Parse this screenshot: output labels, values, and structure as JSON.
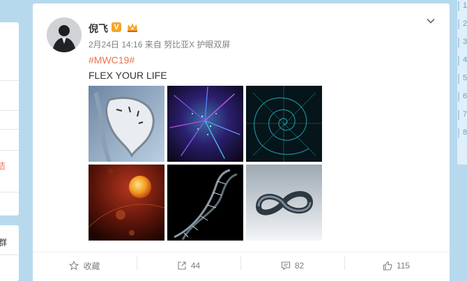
{
  "sidebar": {
    "fragments": [
      {
        "text": "",
        "style": "plain"
      },
      {
        "text": "洁",
        "style": "red"
      },
      {
        "text": "群",
        "style": "plain"
      },
      {
        "text": "",
        "style": "plain"
      }
    ]
  },
  "right_panel": {
    "fragments": [
      "1",
      "2",
      "3",
      "4",
      "5",
      "6",
      "7",
      "8"
    ]
  },
  "post": {
    "author": "倪飞",
    "verified_badge": "V",
    "time": "2月24日 14:16",
    "source_prefix": "来自",
    "source": "努比亚X 护眼双屏",
    "hashtag": "#MWC19#",
    "text": "FLEX YOUR LIFE",
    "images": [
      {
        "name": "melting-clock-image"
      },
      {
        "name": "starfield-image"
      },
      {
        "name": "spiral-image"
      },
      {
        "name": "planets-image"
      },
      {
        "name": "dna-helix-image"
      },
      {
        "name": "infinity-loop-image"
      }
    ]
  },
  "actions": {
    "favorite_label": "收藏",
    "repost_count": "44",
    "comment_count": "82",
    "like_count": "115"
  },
  "colors": {
    "page_bg": "#b7d9ee",
    "accent": "#eb7350",
    "meta_text": "#808080",
    "verified": "#f5a623"
  },
  "icons": {
    "favorite": "star-outline-icon",
    "repost": "share-arrow-icon",
    "comment": "comment-bubble-icon",
    "like": "thumbs-up-icon",
    "menu": "chevron-down-icon"
  }
}
